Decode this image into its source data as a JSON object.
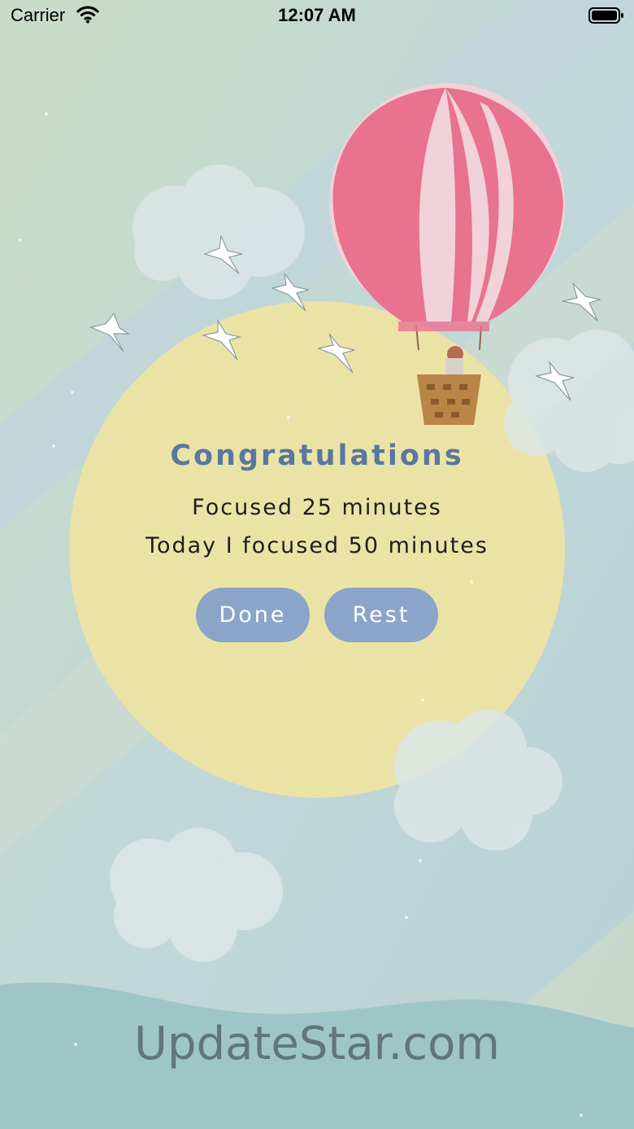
{
  "status_bar": {
    "carrier": "Carrier",
    "time": "12:07 AM"
  },
  "dialog": {
    "title": "Congratulations",
    "focused_line": "Focused 25 minutes",
    "today_line": "Today I focused 50 minutes",
    "done_label": "Done",
    "rest_label": "Rest"
  },
  "watermark": "UpdateStar.com",
  "colors": {
    "sky": "#c3d8d6",
    "sun": "#ebe3a6",
    "button": "#8aa5c7",
    "title": "#5878a0",
    "balloon": "#e8728f"
  }
}
